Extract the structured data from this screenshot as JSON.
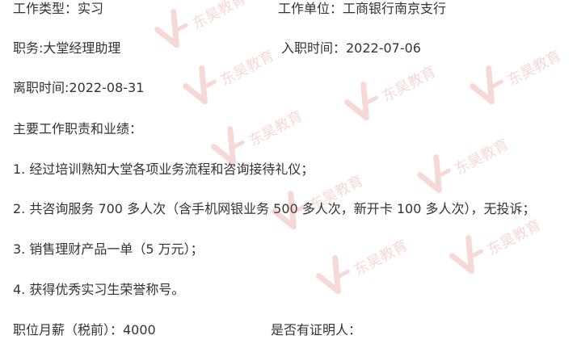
{
  "document": {
    "work_type": "工作类型：实习",
    "work_unit": "工作单位：工商银行南京支行",
    "position": "职务:大堂经理助理",
    "entry_time": "入职时间：2022-07-06",
    "leave_time": "离职时间:2022-08-31",
    "duties_heading": "主要工作职责和业绩：",
    "duties": [
      "1. 经过培训熟知大堂各项业务流程和咨询接待礼仪；",
      "2. 共咨询服务 700 多人次（含手机网银业务 500 多人次，新开卡 100 多人次），无投诉；",
      "3. 销售理财产品一单（5 万元）；",
      "4. 获得优秀实习生荣誉称号。"
    ],
    "salary": "职位月薪（税前）：4000",
    "has_reference": "是否有证明人："
  },
  "watermark": {
    "text": "东昊教育",
    "color": "#d9534f",
    "icon": "v-logo-icon"
  }
}
